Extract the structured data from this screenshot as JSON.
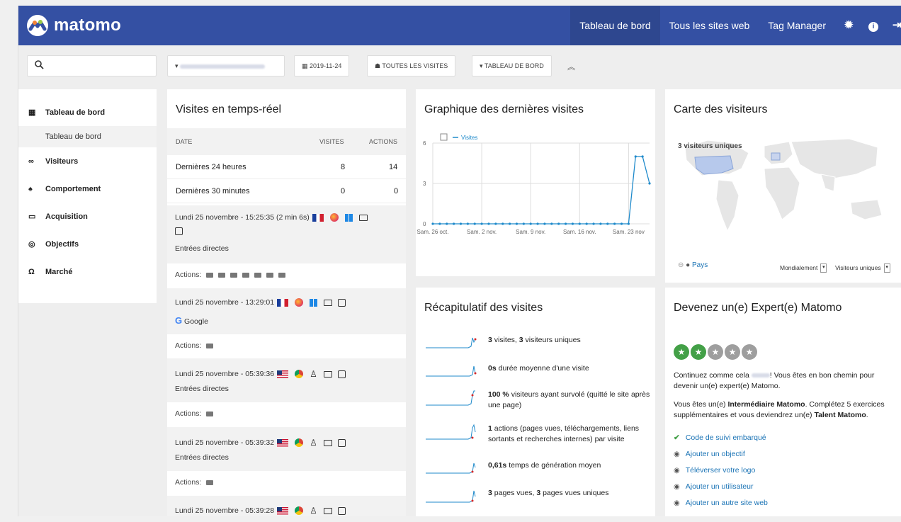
{
  "app": {
    "brand": "matomo"
  },
  "topnav": {
    "items": [
      "Tableau de bord",
      "Tous les sites web",
      "Tag Manager"
    ]
  },
  "subbar": {
    "date": "2019-11-24",
    "segment": "TOUTES LES VISITES",
    "dashboard": "TABLEAU DE BORD"
  },
  "sidebar": {
    "items": [
      "Tableau de bord",
      "Visiteurs",
      "Comportement",
      "Acquisition",
      "Objectifs",
      "Marché"
    ],
    "sub": "Tableau de bord"
  },
  "realtime": {
    "title": "Visites en temps-réel",
    "cols": [
      "DATE",
      "VISITES",
      "ACTIONS"
    ],
    "rows": [
      {
        "label": "Dernières 24 heures",
        "visits": "8",
        "actions": "14"
      },
      {
        "label": "Dernières 30 minutes",
        "visits": "0",
        "actions": "0"
      }
    ],
    "visits": [
      {
        "time": "Lundi 25 novembre - 15:25:35 (2 min 6s)",
        "source": "Entrées directes"
      },
      {
        "time": "Lundi 25 novembre - 13:29:01",
        "source": "Google"
      },
      {
        "time": "Lundi 25 novembre - 05:39:36",
        "source": "Entrées directes"
      },
      {
        "time": "Lundi 25 novembre - 05:39:32",
        "source": "Entrées directes"
      },
      {
        "time": "Lundi 25 novembre - 05:39:28",
        "source": ""
      }
    ],
    "actions_label": "Actions:"
  },
  "graph": {
    "title": "Graphique des dernières visites"
  },
  "chart_data": {
    "type": "line",
    "series": [
      {
        "name": "Visites",
        "values": [
          0,
          0,
          0,
          0,
          0,
          0,
          0,
          0,
          0,
          0,
          0,
          0,
          0,
          0,
          0,
          0,
          0,
          0,
          0,
          0,
          0,
          0,
          0,
          0,
          0,
          0,
          0,
          0,
          0,
          5,
          5,
          3
        ]
      }
    ],
    "x_tick_labels": [
      "Sam. 26 oct.",
      "Sam. 2 nov.",
      "Sam. 9 nov.",
      "Sam. 16 nov.",
      "Sam. 23 nov"
    ],
    "y_ticks": [
      "0",
      "3",
      "6"
    ],
    "ylim": [
      0,
      6
    ],
    "grid": true
  },
  "map": {
    "title": "Carte des visiteurs",
    "label": "3 visiteurs uniques",
    "pays": "Pays",
    "select1": "Mondialement",
    "select2": "Visiteurs uniques"
  },
  "recap": {
    "title": "Récapitulatif des visites",
    "items": [
      {
        "bold": "3",
        "t1": " visites, ",
        "bold2": "3",
        "t2": " visiteurs uniques"
      },
      {
        "bold": "0s",
        "t1": " durée moyenne d'une visite",
        "bold2": "",
        "t2": ""
      },
      {
        "bold": "100 %",
        "t1": " visiteurs ayant survolé (quitté le site après une page)",
        "bold2": "",
        "t2": ""
      },
      {
        "bold": "1",
        "t1": " actions (pages vues, téléchargements, liens sortants et recherches internes) par visite",
        "bold2": "",
        "t2": ""
      },
      {
        "bold": "0,61s",
        "t1": " temps de génération moyen",
        "bold2": "",
        "t2": ""
      },
      {
        "bold": "3",
        "t1": " pages vues, ",
        "bold2": "3",
        "t2": " pages vues uniques"
      }
    ]
  },
  "expert": {
    "title": "Devenez un(e) Expert(e) Matomo",
    "stars_on": 2,
    "stars_total": 5,
    "p1a": "Continuez comme cela",
    "p1b": "! Vous êtes en bon chemin pour devenir un(e) expert(e) Matomo.",
    "p2a": "Vous êtes un(e) ",
    "p2b": "Intermédiaire Matomo",
    "p2c": ". Complétez 5 exercices supplémentaires et vous deviendrez un(e) ",
    "p2d": "Talent Matomo",
    "p2e": ".",
    "tasks": [
      "Code de suivi embarqué",
      "Ajouter un objectif",
      "Téléverser votre logo",
      "Ajouter un utilisateur",
      "Ajouter un autre site web"
    ]
  },
  "colors": {
    "topbar": "#3450a3",
    "accent_green": "#43a047",
    "link": "#1a73b5",
    "line": "#1f8acb"
  }
}
